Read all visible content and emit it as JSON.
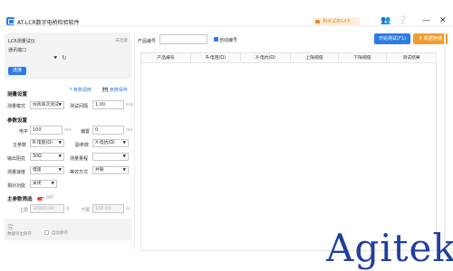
{
  "window": {
    "title": "AT-LCR数字电桥检验软件",
    "trial": "剩余试用14天"
  },
  "conn": {
    "title": "LCR测量试仪",
    "status": "未连接",
    "port_label": "通讯端口",
    "port_value": "",
    "connect_btn": "连接"
  },
  "measure": {
    "section": "测量设置",
    "import_link": "参数调用",
    "save_link": "参数保存",
    "mode_label": "测量模式",
    "mode_value": "仿真单次测试",
    "interval_label": "测试间隔",
    "interval_value": "1.00",
    "interval_unit": "kHz"
  },
  "params": {
    "section": "参数设置",
    "level_label": "电平",
    "level_value": "100",
    "level_unit": "mV",
    "bias_label": "偏置",
    "bias_value": "0",
    "bias_unit": "mV",
    "main_label": "主参数",
    "main_value": "R-电阻(Ω)",
    "sub_label": "副参数",
    "sub_value": "X-电抗(Ω)",
    "outres_label": "输出阻抗",
    "outres_value": "30Ω",
    "range_label": "测量量程",
    "range_value": "",
    "speed_label": "测量速度",
    "speed_value": "慢速",
    "equiv_label": "等效方式",
    "equiv_value": "并联",
    "cal_label": "相对功能",
    "cal_value": "关闭"
  },
  "sorting": {
    "section": "主参数筛选",
    "toggle_label": "OFF",
    "upper_label": "上限",
    "upper_value": "10000.00",
    "upper_unit": "Ω",
    "lower_label": "下限",
    "lower_value": "100.00",
    "lower_unit": "Ω"
  },
  "bottom": {
    "export_label": "数据导出保存",
    "auto_label": "自动保存"
  },
  "main": {
    "product_label": "产品编号",
    "product_value": "",
    "auto_num_label": "自动编号",
    "start_btn": "开始测试(F1)",
    "save_btn": "数据存储"
  },
  "table": {
    "headers": [
      "产品编号",
      "R-电阻(Ω)",
      "X-电抗(Ω)",
      "上限阈值",
      "下限阈值",
      "测试结果"
    ],
    "rows": []
  },
  "brand": "Agitek",
  "colors": {
    "accent": "#2d7be5",
    "orange": "#f39c2c",
    "brand": "#1f3f9f"
  }
}
